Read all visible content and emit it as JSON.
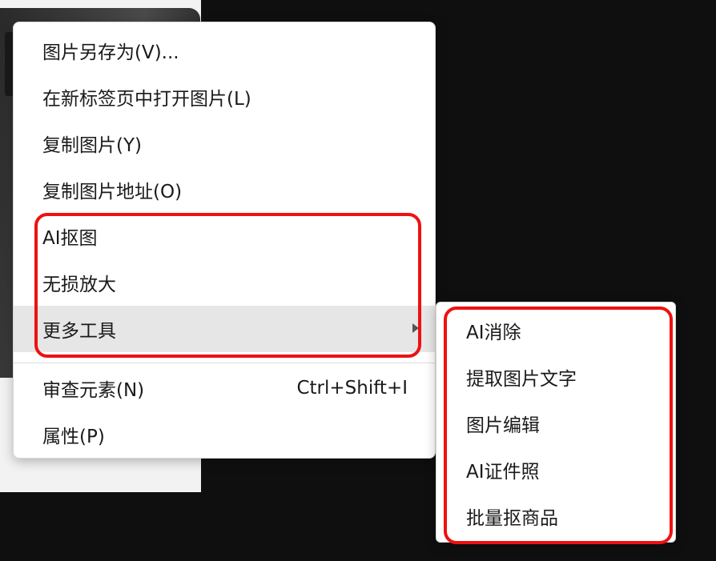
{
  "context_menu": {
    "items": [
      {
        "label": "图片另存为(V)..."
      },
      {
        "label": "在新标签页中打开图片(L)"
      },
      {
        "label": "复制图片(Y)"
      },
      {
        "label": "复制图片地址(O)"
      },
      {
        "label": "AI抠图"
      },
      {
        "label": "无损放大"
      },
      {
        "label": "更多工具",
        "has_submenu": true,
        "hovered": true
      },
      {
        "label": "审查元素(N)",
        "shortcut": "Ctrl+Shift+I"
      },
      {
        "label": "属性(P)"
      }
    ]
  },
  "submenu": {
    "items": [
      {
        "label": "AI消除"
      },
      {
        "label": "提取图片文字"
      },
      {
        "label": "图片编辑"
      },
      {
        "label": "AI证件照"
      },
      {
        "label": "批量抠商品"
      }
    ]
  },
  "colors": {
    "highlight": "#ee1111",
    "hover_bg": "#e6e6e6",
    "background": "#0f0f0f"
  }
}
